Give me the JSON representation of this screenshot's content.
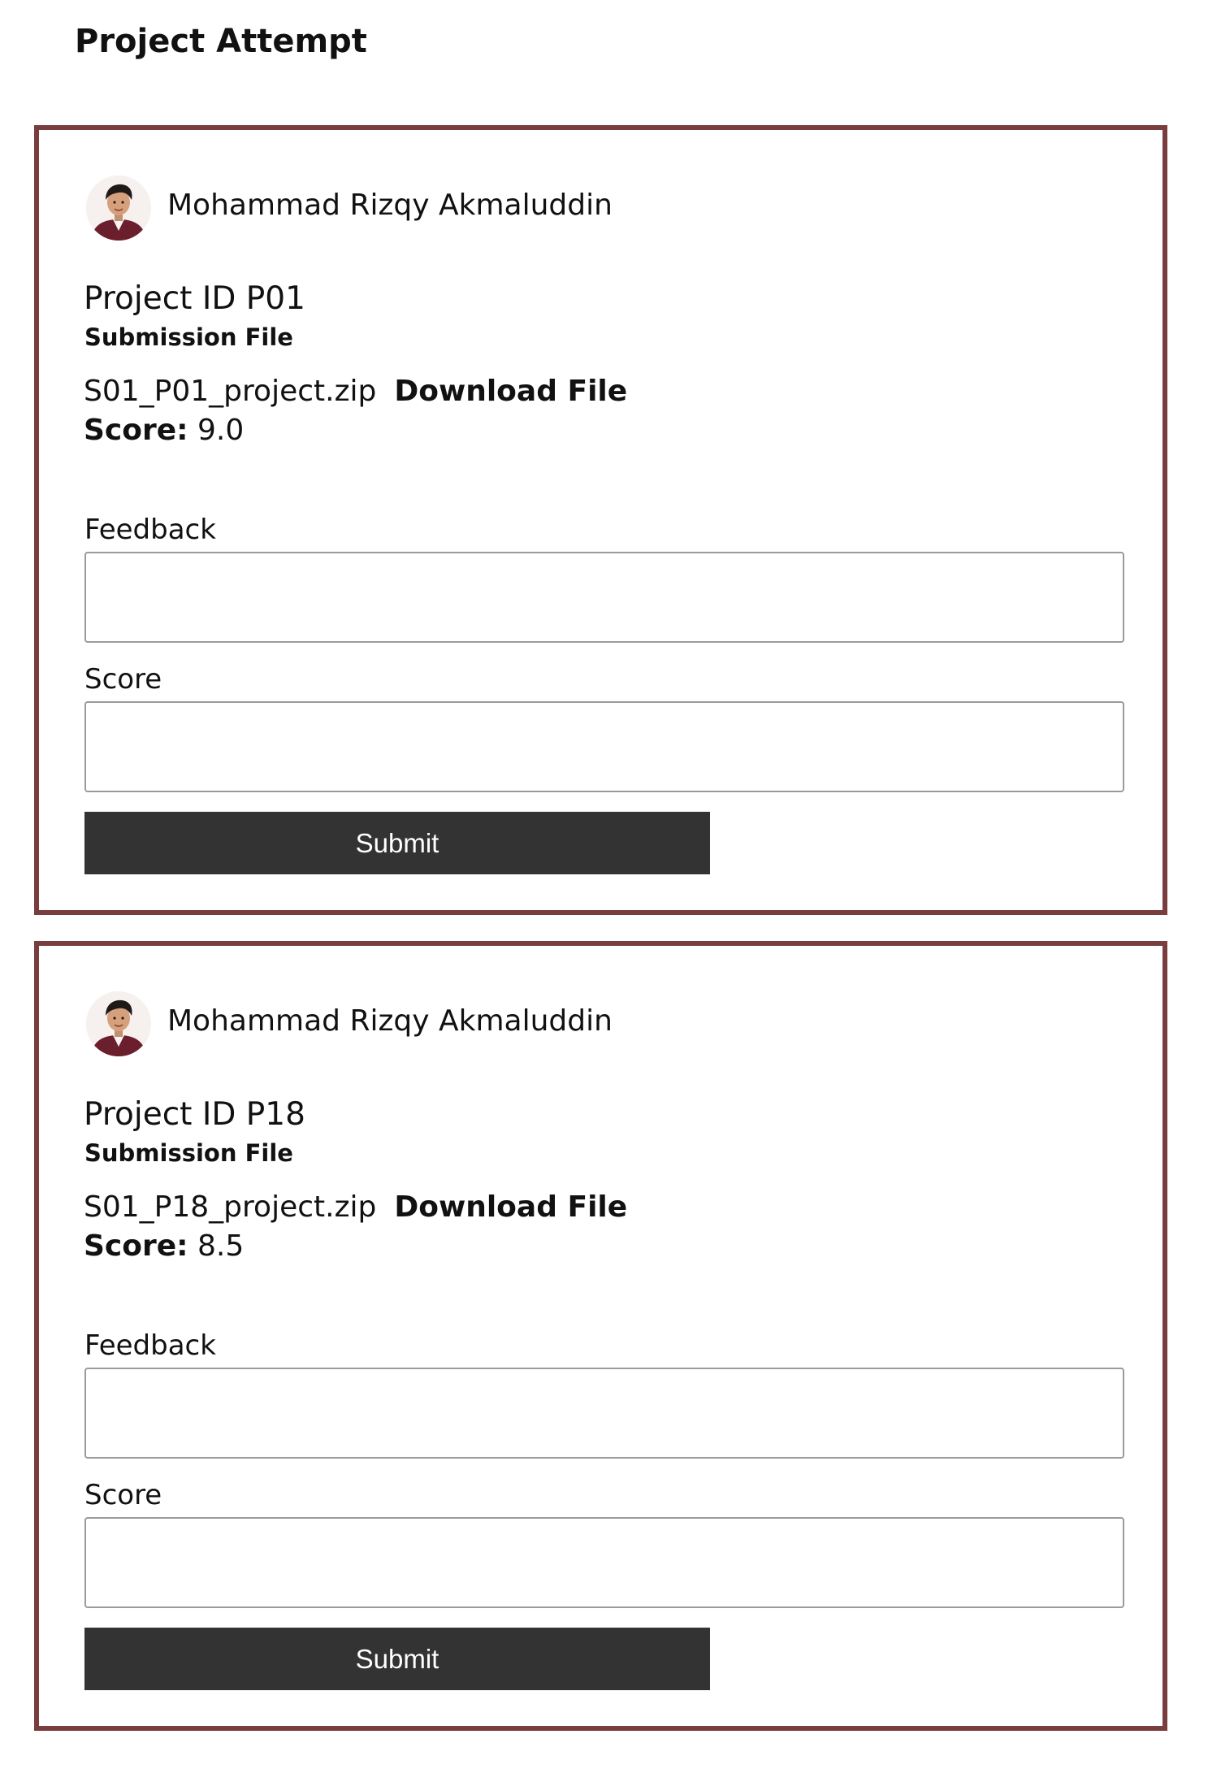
{
  "page": {
    "title": "Project Attempt"
  },
  "attempts": [
    {
      "student_name": "Mohammad Rizqy Akmaluddin",
      "avatar_icon": "student-avatar-photo",
      "project_id": "Project ID P01",
      "submission_label": "Submission File",
      "file_name": "S01_P01_project.zip",
      "download_label": "Download File",
      "score_label": "Score:",
      "score_value": "9.0",
      "feedback_label": "Feedback",
      "feedback_value": "",
      "score_field_label": "Score",
      "score_field_value": "",
      "submit_label": "Submit"
    },
    {
      "student_name": "Mohammad Rizqy Akmaluddin",
      "avatar_icon": "student-avatar-photo",
      "project_id": "Project ID P18",
      "submission_label": "Submission File",
      "file_name": "S01_P18_project.zip",
      "download_label": "Download File",
      "score_label": "Score:",
      "score_value": "8.5",
      "feedback_label": "Feedback",
      "feedback_value": "",
      "score_field_label": "Score",
      "score_field_value": "",
      "submit_label": "Submit"
    }
  ],
  "colors": {
    "card_border": "#7a3d3d",
    "button_background": "#333333",
    "button_text": "#ffffff",
    "input_border": "#9a9a9a"
  }
}
